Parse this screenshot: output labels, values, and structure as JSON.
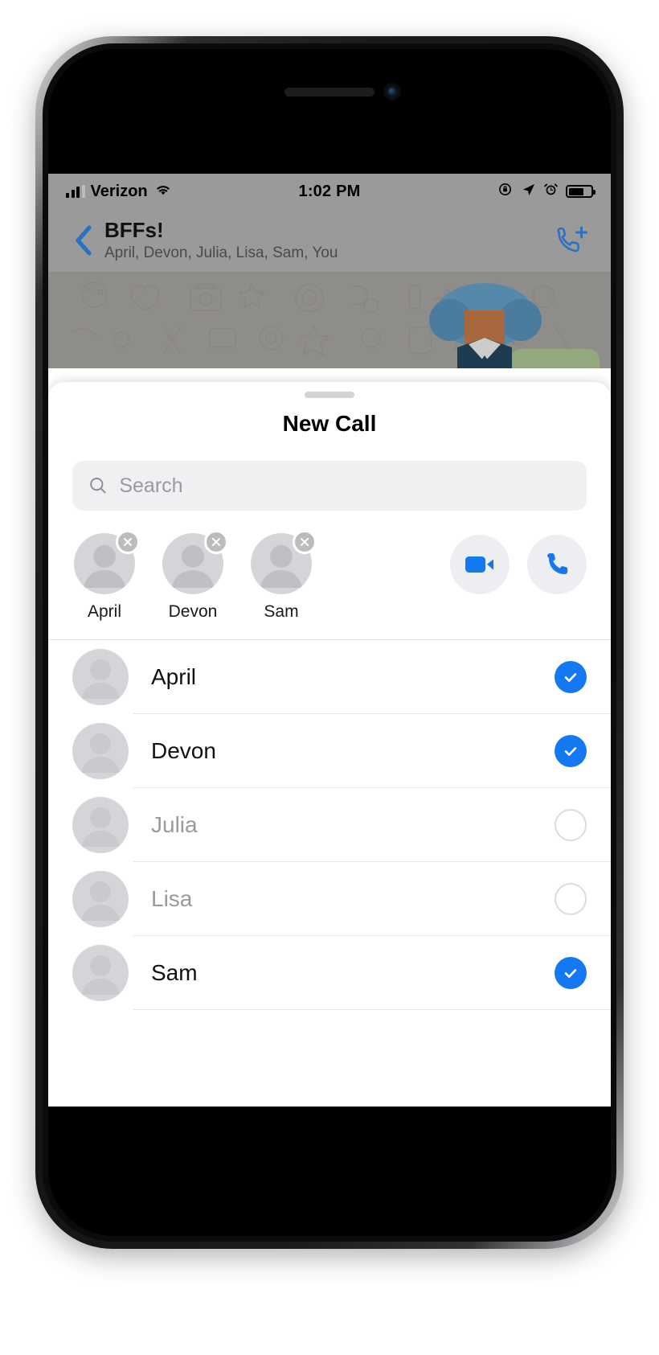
{
  "status_bar": {
    "carrier": "Verizon",
    "time": "1:02 PM",
    "signal_icon": "signal-bars-icon",
    "wifi_icon": "wifi-icon",
    "rotation_lock_icon": "rotation-lock-icon",
    "location_icon": "location-arrow-icon",
    "alarm_icon": "alarm-clock-icon",
    "battery_icon": "battery-icon"
  },
  "nav_bar": {
    "back_icon": "chevron-left-icon",
    "title": "BFFs!",
    "subtitle": "April, Devon, Julia, Lisa, Sam, You",
    "new_call_icon": "phone-plus-icon"
  },
  "sheet": {
    "grabber": "drag-handle",
    "title": "New Call",
    "search": {
      "icon": "search-icon",
      "placeholder": "Search",
      "value": ""
    },
    "selected": [
      {
        "name": "April",
        "avatar": "person-placeholder-avatar",
        "remove_icon": "close-icon"
      },
      {
        "name": "Devon",
        "avatar": "person-placeholder-avatar",
        "remove_icon": "close-icon"
      },
      {
        "name": "Sam",
        "avatar": "person-placeholder-avatar",
        "remove_icon": "close-icon"
      }
    ],
    "actions": [
      {
        "id": "video-call",
        "icon": "video-camera-icon"
      },
      {
        "id": "audio-call",
        "icon": "phone-handset-icon"
      }
    ],
    "contacts": [
      {
        "name": "April",
        "selected": true,
        "avatar": "person-placeholder-avatar",
        "check_icon": "checkmark-filled-icon"
      },
      {
        "name": "Devon",
        "selected": true,
        "avatar": "person-placeholder-avatar",
        "check_icon": "checkmark-filled-icon"
      },
      {
        "name": "Julia",
        "selected": false,
        "avatar": "person-placeholder-avatar",
        "check_icon": "circle-empty-icon"
      },
      {
        "name": "Lisa",
        "selected": false,
        "avatar": "person-placeholder-avatar",
        "check_icon": "circle-empty-icon"
      },
      {
        "name": "Sam",
        "selected": true,
        "avatar": "person-placeholder-avatar",
        "check_icon": "checkmark-filled-icon"
      }
    ]
  },
  "colors": {
    "accent_blue": "#1479f0",
    "nav_blue": "#2a71c4",
    "status_bar_gray": "#9a9a9a",
    "avatar_gray": "#d5d5d9",
    "chip_badge_gray": "#bcbcbf",
    "search_field_gray": "#f0f0f2",
    "disabled_text_gray": "#9a9a9e",
    "action_button_gray": "#eceef1"
  }
}
